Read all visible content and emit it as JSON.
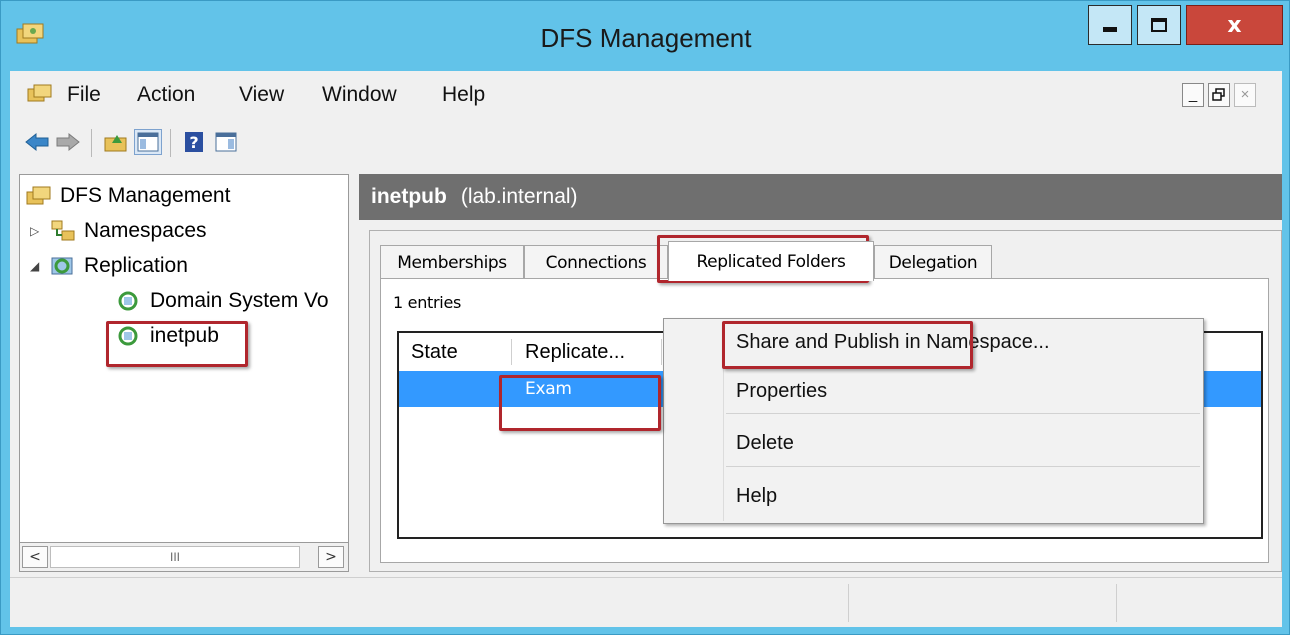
{
  "window": {
    "title": "DFS Management",
    "controls": {
      "minimize": "minimize",
      "maximize": "maximize",
      "close": "x"
    }
  },
  "menubar": {
    "items": [
      "File",
      "Action",
      "View",
      "Window",
      "Help"
    ],
    "mdi_controls": [
      "_",
      "restore",
      "×"
    ]
  },
  "toolbar": {
    "buttons": [
      "back-arrow-icon",
      "forward-arrow-icon",
      "up-folder-icon",
      "show-hide-console-tree-icon",
      "help-icon",
      "show-hide-action-pane-icon"
    ]
  },
  "tree": {
    "root": "DFS Management",
    "items": [
      {
        "label": "Namespaces",
        "expander": "▷"
      },
      {
        "label": "Replication",
        "expander": "◢"
      },
      {
        "label": "Domain System Vo"
      },
      {
        "label": "inetpub"
      }
    ],
    "scroll_mid": "III",
    "scroll_left": "<",
    "scroll_right": ">"
  },
  "pane": {
    "title": "inetpub",
    "subtitle": "(lab.internal)",
    "tabs": [
      "Memberships",
      "Connections",
      "Replicated Folders",
      "Delegation"
    ],
    "active_tab": "Replicated Folders",
    "entries": "1 entries",
    "columns": [
      "State",
      "Replicate..."
    ],
    "rows": [
      {
        "state": "",
        "replicated_folder": "Exam"
      }
    ]
  },
  "context_menu": {
    "items": [
      "Share and Publish in Namespace...",
      "Properties",
      "Delete",
      "Help"
    ]
  },
  "colors": {
    "title_bar": "#62c3e9",
    "close_button": "#c9473b",
    "selection": "#3399ff",
    "highlight_box": "#b0262d",
    "pane_header": "#6f6f6f"
  }
}
